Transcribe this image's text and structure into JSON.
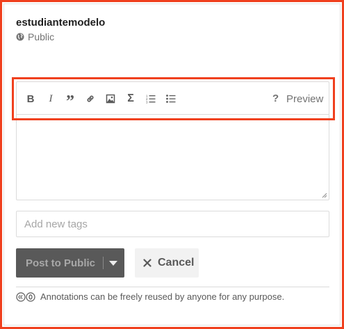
{
  "annotation": {
    "username": "estudiantemodelo",
    "visibility_label": "Public"
  },
  "editor": {
    "toolbar": {
      "buttons": [
        {
          "name": "bold",
          "glyph": "B"
        },
        {
          "name": "italic",
          "glyph": "I"
        },
        {
          "name": "quote",
          "glyph": "”"
        },
        {
          "name": "link",
          "icon": "link-icon"
        },
        {
          "name": "image",
          "icon": "image-icon"
        },
        {
          "name": "math",
          "glyph": "Σ"
        },
        {
          "name": "numbered-list",
          "icon": "numbered-list-icon"
        },
        {
          "name": "bulleted-list",
          "icon": "bulleted-list-icon"
        }
      ],
      "help_label": "?",
      "preview_label": "Preview"
    },
    "text_value": ""
  },
  "tags": {
    "placeholder": "Add new tags",
    "value": ""
  },
  "actions": {
    "post_label": "Post to Public",
    "cancel_label": "Cancel"
  },
  "license": {
    "text": "Annotations can be freely reused by anyone for any purpose."
  },
  "colors": {
    "highlight": "#f0401e",
    "post_button_bg": "#595959",
    "cancel_button_bg": "#f2f2f2",
    "muted_text": "#737373"
  }
}
